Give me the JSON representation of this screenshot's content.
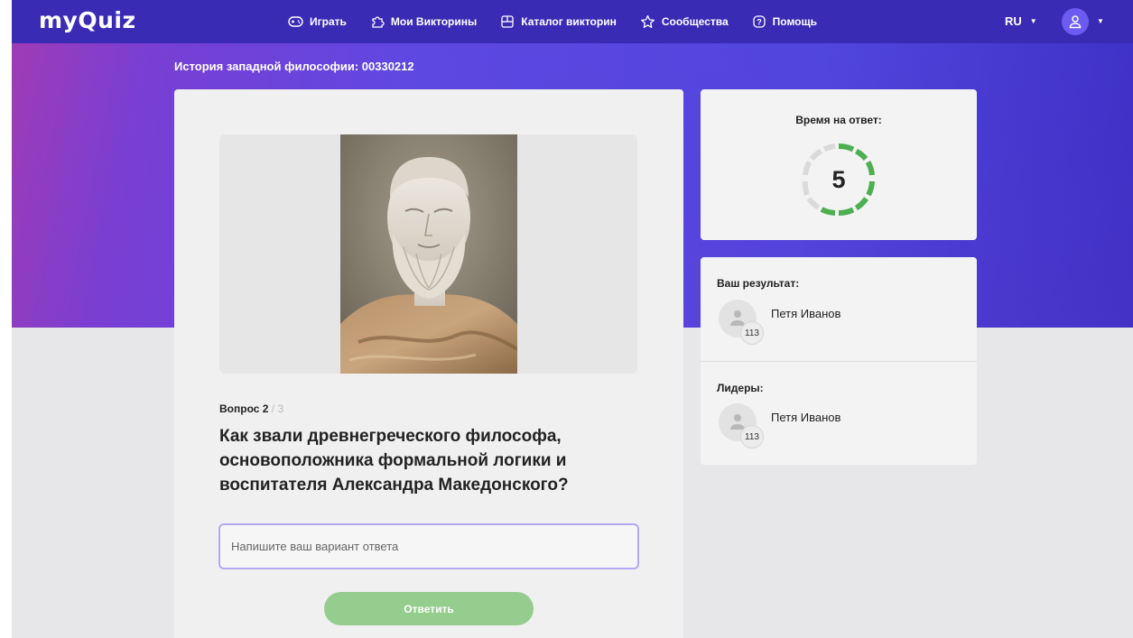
{
  "header": {
    "logo": "myQuiz",
    "nav": [
      {
        "label": "Играть",
        "icon": "gamepad-icon"
      },
      {
        "label": "Мои Викторины",
        "icon": "puzzle-icon"
      },
      {
        "label": "Каталог викторин",
        "icon": "catalog-icon"
      },
      {
        "label": "Сообщества",
        "icon": "star-icon"
      },
      {
        "label": "Помощь",
        "icon": "help-icon"
      }
    ],
    "language": "RU",
    "colors": {
      "bar": "#3a2bb5",
      "accent": "#5d48e2"
    }
  },
  "quiz": {
    "title": "История западной философии: 00330212"
  },
  "question": {
    "label": "Вопрос 2",
    "total": "/ 3",
    "text": "Как звали древнегреческого философа, основоположника формальной логики и воспитателя Александра Македонского?",
    "input_placeholder": "Напишите ваш вариант ответа",
    "submit_label": "Ответить",
    "submit_color": "#95cd8e"
  },
  "timer": {
    "label": "Время на ответ:",
    "value": "5",
    "ring_color": "#4caf50"
  },
  "results": {
    "your_result_label": "Ваш результат:",
    "your_result": {
      "name": "Петя Иванов",
      "score": "113"
    },
    "leaders_label": "Лидеры:",
    "leaders": [
      {
        "name": "Петя Иванов",
        "score": "113"
      }
    ]
  }
}
